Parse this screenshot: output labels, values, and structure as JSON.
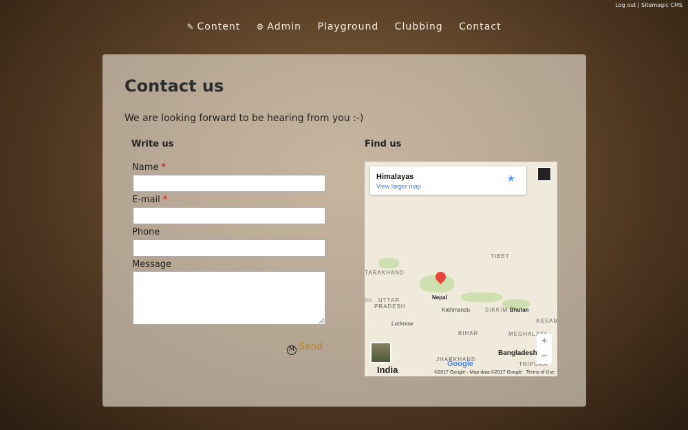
{
  "top_links": {
    "logout": "Log out",
    "separator": "|",
    "cms": "Sitemagic CMS"
  },
  "menu": [
    {
      "label": "Content",
      "icon": "edit-icon"
    },
    {
      "label": "Admin",
      "icon": "gear-icon"
    },
    {
      "label": "Playground"
    },
    {
      "label": "Clubbing"
    },
    {
      "label": "Contact"
    }
  ],
  "page": {
    "title": "Contact us",
    "intro": "We are looking forward to be hearing from you :-)"
  },
  "form": {
    "heading": "Write us",
    "name_label": "Name",
    "email_label": "E-mail",
    "phone_label": "Phone",
    "message_label": "Message",
    "required_mark": "*",
    "name_value": "",
    "email_value": "",
    "phone_value": "",
    "message_value": "",
    "send_label": "Send"
  },
  "map": {
    "heading": "Find us",
    "place": "Himalayas",
    "larger_map": "View larger map",
    "labels": {
      "tibet": "TIBET",
      "tarakhand": "TARAKHAND",
      "uttar": "UTTAR",
      "pradesh": "PRADESH",
      "nepal": "Nepal",
      "kathmandu": "Kathmandu",
      "lucknow": "Lucknow",
      "bihar": "BIHAR",
      "sikkim": "SIKKIM",
      "bhutan": "Bhutan",
      "assam": "ASSAM",
      "meghalaya": "MEGHALAYA",
      "bangladesh": "Bangladesh",
      "jharkhand": "JHARKHAND",
      "tripura": "TRIPURA",
      "india": "India",
      "delhi": "lhi"
    },
    "zoom_in": "+",
    "zoom_out": "−",
    "google": "Google",
    "attribution": "©2017 Google · Map data ©2017 Google",
    "terms": "Terms of Use",
    "pin_color": "#e8453c"
  },
  "colors": {
    "send": "#b8862a",
    "required": "#ee0000",
    "link": "#3a7de0"
  }
}
